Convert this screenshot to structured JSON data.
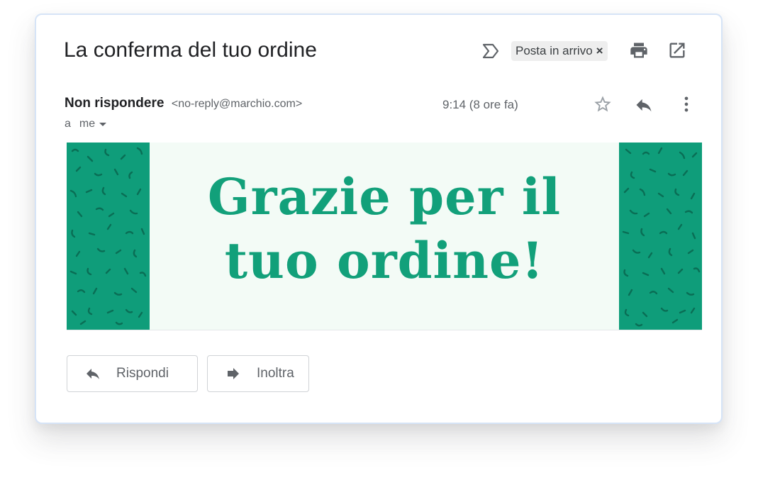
{
  "email": {
    "subject": "La conferma del tuo ordine",
    "label": "Posta in arrivo",
    "label_remove": "×",
    "sender_name": "Non rispondere",
    "sender_email": "<no-reply@marchio.com>",
    "to_prefix": "a",
    "to_name": "me",
    "timestamp": "9:14 (8 ore fa)"
  },
  "banner": {
    "line1": "Grazie per il",
    "line2": "tuo ordine!",
    "text_color": "#12a07a",
    "pattern_color": "#0f9d7a",
    "background": "#f3fbf6"
  },
  "actions": {
    "reply_label": "Rispondi",
    "forward_label": "Inoltra"
  },
  "icons": {
    "important": "important-marker-icon",
    "print": "print-icon",
    "open_new_window": "open-in-new-icon",
    "star": "star-icon",
    "reply": "reply-icon",
    "more": "more-vert-icon",
    "forward": "forward-icon"
  }
}
